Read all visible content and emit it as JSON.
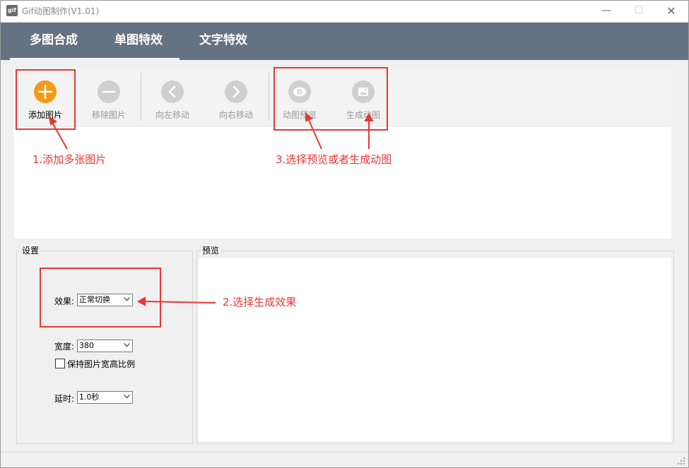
{
  "window": {
    "title": "Gif动图制作(V1.01)",
    "icon_text": "gif",
    "minimize_glyph": "—",
    "maximize_glyph": "☐",
    "close_glyph": "✕"
  },
  "tabs": [
    {
      "label": "多图合成",
      "active": true
    },
    {
      "label": "单图特效",
      "active": false
    },
    {
      "label": "文字特效",
      "active": false
    }
  ],
  "toolbar": {
    "buttons": [
      {
        "label": "添加图片",
        "icon": "plus-icon",
        "enabled": true
      },
      {
        "label": "移除图片",
        "icon": "minus-icon",
        "enabled": false
      },
      {
        "label": "向左移动",
        "icon": "chevron-left-icon",
        "enabled": false
      },
      {
        "label": "向右移动",
        "icon": "chevron-right-icon",
        "enabled": false
      },
      {
        "label": "动图预览",
        "icon": "eye-icon",
        "enabled": false
      },
      {
        "label": "生成动图",
        "icon": "image-icon",
        "enabled": false
      }
    ]
  },
  "settings": {
    "group_title": "设置",
    "effect_label": "效果:",
    "effect_value": "正常切换",
    "width_label": "宽度:",
    "width_value": "380",
    "keep_ratio_label": "保持图片宽高比例",
    "keep_ratio_checked": false,
    "delay_label": "延时:",
    "delay_value": "1.0秒"
  },
  "preview": {
    "group_title": "预览"
  },
  "annotations": {
    "step1": "1.添加多张图片",
    "step2": "2.选择生成效果",
    "step3": "3.选择预览或者生成动图",
    "color": "#e53935"
  },
  "colors": {
    "tabbar": "#657282",
    "accent_orange": "#f59a14",
    "disabled_icon": "#cfcfcf"
  }
}
